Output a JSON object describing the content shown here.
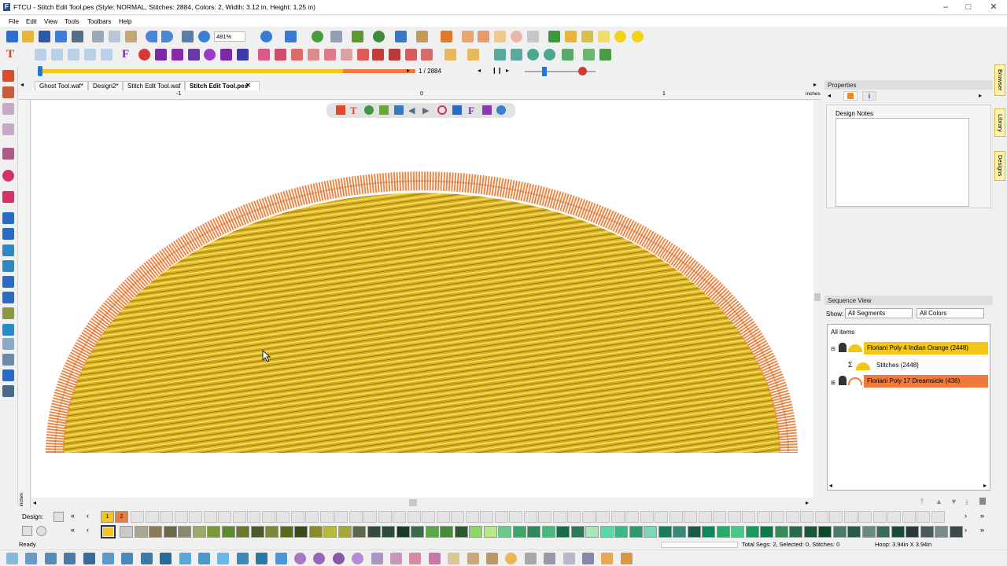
{
  "window": {
    "title": "FTCU - Stitch Edit Tool.pes (Style: NORMAL, Stitches: 2884, Colors: 2, Width: 3.12 in, Height: 1.25 in)"
  },
  "menu": [
    "File",
    "Edit",
    "View",
    "Tools",
    "Toolbars",
    "Help"
  ],
  "toolbar": {
    "zoom": "481%"
  },
  "progress": {
    "counter": "1 / 2884"
  },
  "tabs": [
    "Ghost Tool.waf*",
    "Design2*",
    "Stitch Edit Tool.waf",
    "Stitch Edit Tool.pes"
  ],
  "ruler": {
    "labels": [
      "-1",
      "0",
      "1"
    ],
    "unit": "inches",
    "unit_left": "inches"
  },
  "properties": {
    "header": "Properties",
    "design_notes_label": "Design Notes",
    "design_notes_value": ""
  },
  "sequence": {
    "header": "Sequence View",
    "show_label": "Show:",
    "filter_segments": "All Segments",
    "filter_colors": "All Colors",
    "all_items": "All items",
    "items": [
      {
        "label": "Floriani Poly 4 Indian Orange (2448)",
        "color": "#f5c518"
      },
      {
        "label": "Stitches (2448)",
        "color": "#ffffff"
      },
      {
        "label": "Floriani Poly 17 Dreamsicle (436)",
        "color": "#f07a3a"
      }
    ]
  },
  "side_tabs": [
    "Browser",
    "Library",
    "Designs"
  ],
  "palette": {
    "design_label": "Design:",
    "design_colors": [
      "1",
      "2"
    ],
    "design_color_values": [
      "#f5c518",
      "#f07a3a"
    ]
  },
  "status": {
    "ready": "Ready",
    "segs": "Total Segs: 2, Selected: 0, Stitches: 0",
    "hoop": "Hoop: 3.94in X 3.94in"
  },
  "colors": {
    "fill": "#d9b21f",
    "border": "#e8894a",
    "accent": "#1e7ad6"
  }
}
